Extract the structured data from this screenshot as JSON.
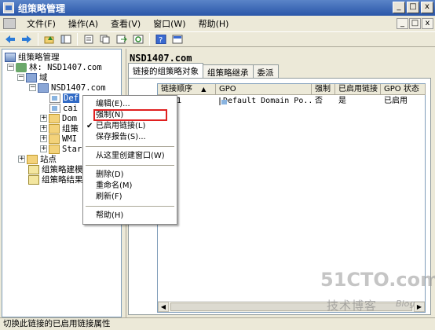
{
  "window": {
    "title": "组策略管理"
  },
  "menubar": {
    "items": [
      "文件(F)",
      "操作(A)",
      "查看(V)",
      "窗口(W)",
      "帮助(H)"
    ]
  },
  "titlebar_buttons": {
    "min": "_",
    "max": "□",
    "close": "x"
  },
  "mdi_buttons": {
    "min": "_",
    "max": "□",
    "close": "x"
  },
  "toolbar": {
    "icons": [
      "back-icon",
      "forward-icon",
      "up-icon",
      "show-tree-icon",
      "properties-icon",
      "copy-icon",
      "export-icon",
      "refresh-icon",
      "help-icon",
      "console-icon"
    ]
  },
  "tree": {
    "root": "组策略管理",
    "forest": "林: NSD1407.com",
    "domains": "域",
    "domain": "NSD1407.com",
    "items": [
      "Default Domain Policy",
      "caiwu",
      "Domain Controllers",
      "组策略对象",
      "WMI 筛选器",
      "Starter GPO"
    ],
    "items_visible": [
      "Def",
      "cai",
      "Dom",
      "组策",
      "WMI",
      "Star"
    ],
    "sites": "站点",
    "modeling": "组策略建模",
    "results": "组策略结果"
  },
  "right": {
    "title": "NSD1407.com",
    "tabs": [
      "链接的组策略对象",
      "组策略继承",
      "委派"
    ],
    "columns": [
      "链接顺序",
      "GPO",
      "强制",
      "已启用链接",
      "GPO 状态"
    ],
    "rows": [
      {
        "order": "1",
        "gpo": "Default Domain Po...",
        "enforced": "否",
        "link_enabled": "是",
        "status": "已启用"
      }
    ]
  },
  "context_menu": {
    "items": [
      {
        "label": "编辑(E)...",
        "checked": false
      },
      {
        "label": "强制(N)",
        "checked": false
      },
      {
        "label": "已启用链接(L)",
        "checked": true
      },
      {
        "label": "保存报告(S)...",
        "checked": false
      },
      {
        "label": "从这里创建窗口(W)",
        "checked": false
      },
      {
        "label": "删除(D)",
        "checked": false
      },
      {
        "label": "重命名(M)",
        "checked": false
      },
      {
        "label": "刷新(F)",
        "checked": false
      },
      {
        "label": "帮助(H)",
        "checked": false
      }
    ],
    "check_mark": "✔"
  },
  "statusbar": {
    "text": "切换此链接的已启用链接属性"
  },
  "watermark": {
    "site": "51CTO.com",
    "tagline": "技术博客",
    "blog": "Blog"
  },
  "colors": {
    "titlebar": "#2a56a8",
    "selection": "#316ac5",
    "highlight_box": "#e02020"
  }
}
